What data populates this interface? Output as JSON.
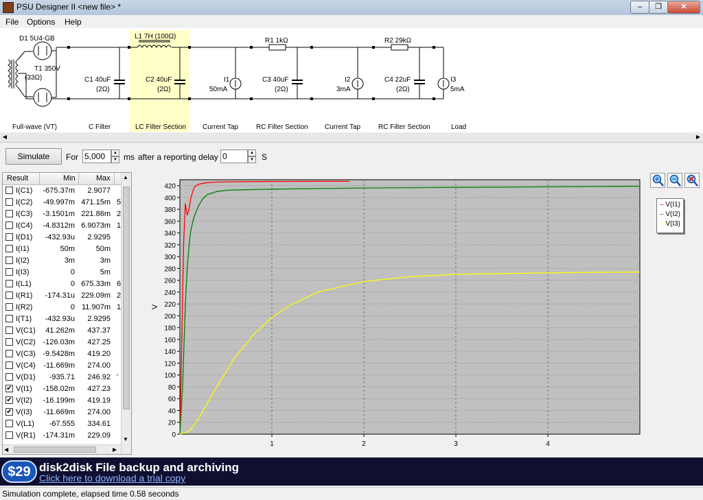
{
  "window": {
    "title": "PSU Designer II  <new file> *",
    "minimize": "–",
    "maximize": "❐",
    "close": "✕"
  },
  "menu": [
    "File",
    "Options",
    "Help"
  ],
  "schematic": {
    "d1": "D1 5U4-GB",
    "t1": "T1 350V",
    "t1_r": "(33Ω)",
    "l1": "L1 7H (100Ω)",
    "r1": "R1 1kΩ",
    "r2": "R2 29kΩ",
    "c1": "C1 40uF",
    "c1_r": "(2Ω)",
    "c2": "C2 40uF",
    "c2_r": "(2Ω)",
    "i1": "I1",
    "i1_v": "50mA",
    "c3": "C3 40uF",
    "c3_r": "(2Ω)",
    "i2": "I2",
    "i2_v": "3mA",
    "c4": "C4 22uF",
    "c4_r": "(2Ω)",
    "i3": "I3",
    "i3_v": "5mA",
    "sections": [
      "Full-wave (VT)",
      "C Filter",
      "LC Filter Section",
      "Current Tap",
      "RC Filter Section",
      "Current Tap",
      "RC Filter Section",
      "Load"
    ]
  },
  "sim": {
    "button": "Simulate",
    "for_label": "For",
    "duration": "5,000",
    "ms_label": "ms",
    "delay_label": "after a reporting delay of",
    "delay": "0",
    "s_label": "S"
  },
  "results": {
    "headers": [
      "Result",
      "Min",
      "Max"
    ],
    "rows": [
      {
        "name": "I(C1)",
        "min": "-675.37m",
        "max": "2.9077",
        "checked": false,
        "extra": ""
      },
      {
        "name": "I(C2)",
        "min": "-49.997m",
        "max": "471.15m",
        "checked": false,
        "extra": "5"
      },
      {
        "name": "I(C3)",
        "min": "-3.1501m",
        "max": "221.86m",
        "checked": false,
        "extra": "2"
      },
      {
        "name": "I(C4)",
        "min": "-4.8312m",
        "max": "6.9073m",
        "checked": false,
        "extra": "1"
      },
      {
        "name": "I(D1)",
        "min": "-432.93u",
        "max": "2.9295",
        "checked": false,
        "extra": ""
      },
      {
        "name": "I(I1)",
        "min": "50m",
        "max": "50m",
        "checked": false,
        "extra": ""
      },
      {
        "name": "I(I2)",
        "min": "3m",
        "max": "3m",
        "checked": false,
        "extra": ""
      },
      {
        "name": "I(I3)",
        "min": "0",
        "max": "5m",
        "checked": false,
        "extra": ""
      },
      {
        "name": "I(L1)",
        "min": "0",
        "max": "675.33m",
        "checked": false,
        "extra": "6"
      },
      {
        "name": "I(R1)",
        "min": "-174.31u",
        "max": "229.09m",
        "checked": false,
        "extra": "2"
      },
      {
        "name": "I(R2)",
        "min": "0",
        "max": "11.907m",
        "checked": false,
        "extra": "1"
      },
      {
        "name": "I(T1)",
        "min": "-432.93u",
        "max": "2.9295",
        "checked": false,
        "extra": ""
      },
      {
        "name": "V(C1)",
        "min": "41.262m",
        "max": "437.37",
        "checked": false,
        "extra": ""
      },
      {
        "name": "V(C2)",
        "min": "-126.03m",
        "max": "427.25",
        "checked": false,
        "extra": ""
      },
      {
        "name": "V(C3)",
        "min": "-9.5428m",
        "max": "419.20",
        "checked": false,
        "extra": ""
      },
      {
        "name": "V(C4)",
        "min": "-11.669m",
        "max": "274.00",
        "checked": false,
        "extra": ""
      },
      {
        "name": "V(D1)",
        "min": "-935.71",
        "max": "246.92",
        "checked": false,
        "extra": "'"
      },
      {
        "name": "V(I1)",
        "min": "-158.02m",
        "max": "427.23",
        "checked": true,
        "extra": ""
      },
      {
        "name": "V(I2)",
        "min": "-16.199m",
        "max": "419.19",
        "checked": true,
        "extra": ""
      },
      {
        "name": "V(I3)",
        "min": "-11.669m",
        "max": "274.00",
        "checked": true,
        "extra": ""
      },
      {
        "name": "V(L1)",
        "min": "-67.555",
        "max": "334.61",
        "checked": false,
        "extra": ""
      },
      {
        "name": "V(R1)",
        "min": "-174.31m",
        "max": "229.09",
        "checked": false,
        "extra": ""
      }
    ],
    "check_mark": "✔"
  },
  "chart_data": {
    "type": "line",
    "ylabel": "V",
    "xlim": [
      0,
      5
    ],
    "ylim": [
      0,
      430
    ],
    "xticks": [
      1,
      2,
      3,
      4
    ],
    "yticks": [
      0,
      20,
      40,
      60,
      80,
      100,
      120,
      140,
      160,
      180,
      200,
      220,
      240,
      260,
      280,
      300,
      320,
      340,
      360,
      380,
      400,
      420
    ],
    "grid": true,
    "legend_position": "right",
    "series": [
      {
        "name": "V(I1)",
        "color": "#ff0000",
        "x": [
          0,
          0.02,
          0.04,
          0.06,
          0.08,
          0.1,
          0.12,
          0.14,
          0.16,
          0.18,
          0.2,
          0.25,
          0.3,
          0.4,
          0.6,
          1.0,
          1.5,
          1.84
        ],
        "y": [
          0,
          150,
          320,
          390,
          370,
          380,
          400,
          410,
          418,
          420,
          422,
          424,
          425,
          426,
          426.5,
          427,
          427.2,
          427.2
        ]
      },
      {
        "name": "V(I2)",
        "color": "#008000",
        "x": [
          0,
          0.03,
          0.06,
          0.08,
          0.1,
          0.12,
          0.15,
          0.2,
          0.25,
          0.3,
          0.4,
          0.5,
          0.7,
          1.0,
          1.5,
          2.0,
          3.0,
          4.0,
          5.0
        ],
        "y": [
          0,
          80,
          220,
          280,
          320,
          345,
          365,
          385,
          398,
          405,
          410,
          412,
          413,
          414,
          415,
          416,
          417,
          418,
          419
        ]
      },
      {
        "name": "V(I3)",
        "color": "#ffff00",
        "x": [
          0,
          0.1,
          0.2,
          0.4,
          0.6,
          0.8,
          1.0,
          1.2,
          1.5,
          2.0,
          2.5,
          3.0,
          3.5,
          4.0,
          4.5,
          5.0
        ],
        "y": [
          0,
          5,
          25,
          80,
          130,
          168,
          197,
          218,
          240,
          258,
          266,
          270,
          271.5,
          272.5,
          273.5,
          274
        ]
      }
    ]
  },
  "banner": {
    "price": "$29",
    "headline": "disk2disk File backup and archiving",
    "link": "Click here to download a trial copy"
  },
  "status": "Simulation complete, elapsed time 0.58 seconds"
}
